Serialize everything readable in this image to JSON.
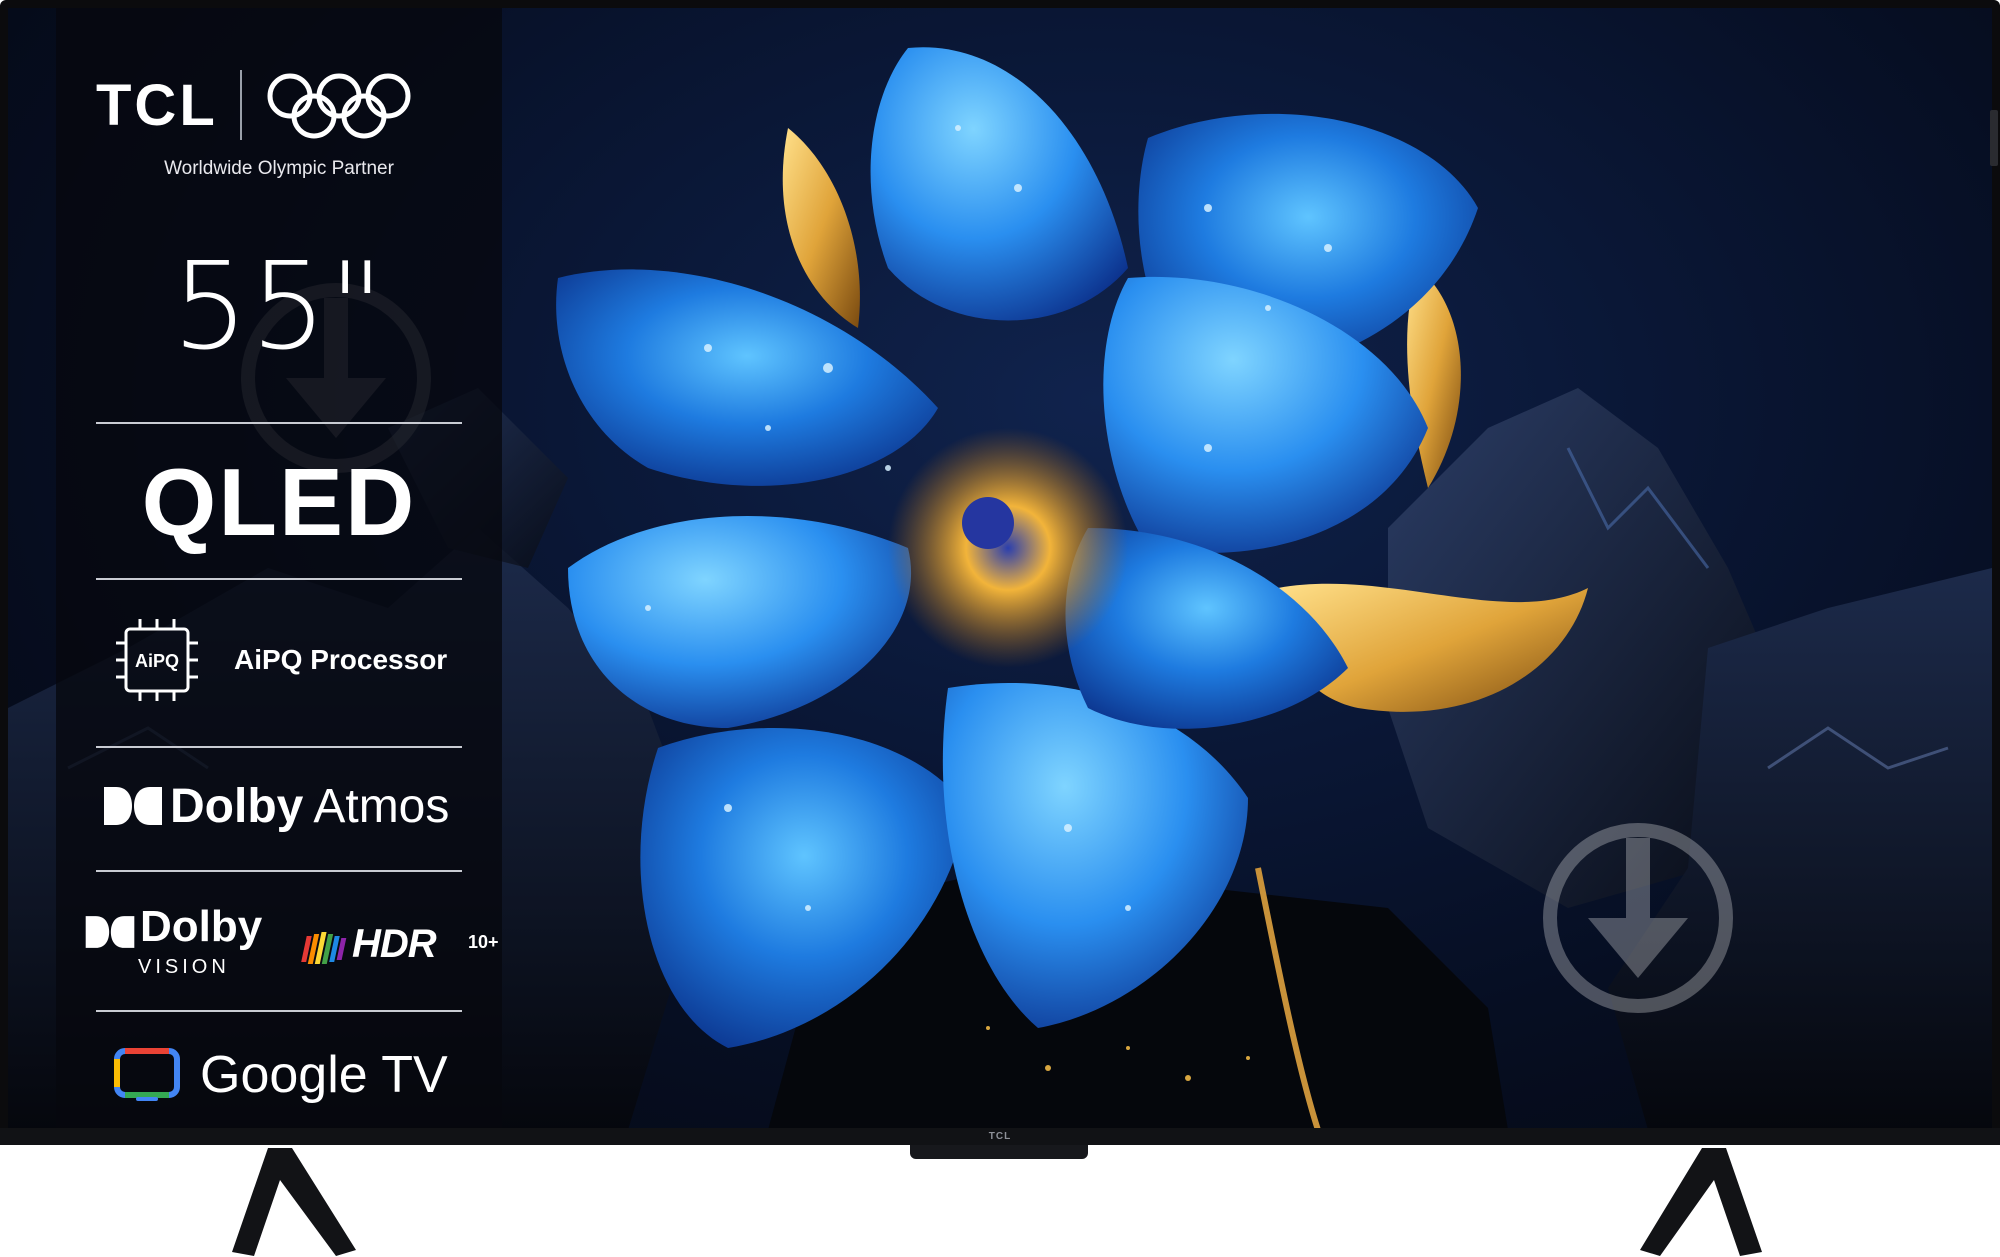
{
  "product": {
    "brand": "TCL",
    "partner_text": "Worldwide Olympic Partner",
    "screen_size": "55\"",
    "display_tech": "QLED",
    "processor": {
      "chip_label": "AiPQ",
      "label": "AiPQ Processor"
    },
    "audio": {
      "dolby": "Dolby",
      "atmos": "Atmos"
    },
    "video": {
      "dolby": "Dolby",
      "vision": "VISION",
      "hdr": "HDR",
      "hdr_suffix": "10+"
    },
    "platform": "Google TV",
    "bezel_logo": "TCL"
  },
  "colors": {
    "panel_bg": "#06080e",
    "flower_blue": "#1e7be0",
    "flower_gold": "#e0a43a",
    "gtv_red": "#ea4335",
    "gtv_yellow": "#fbbc04",
    "gtv_green": "#34a853",
    "gtv_blue": "#4285f4"
  },
  "icons": [
    "olympic-rings-icon",
    "aipq-chip-icon",
    "dolby-double-d-icon",
    "hdr-stripes-icon",
    "google-tv-icon",
    "download-watermark-icon"
  ]
}
